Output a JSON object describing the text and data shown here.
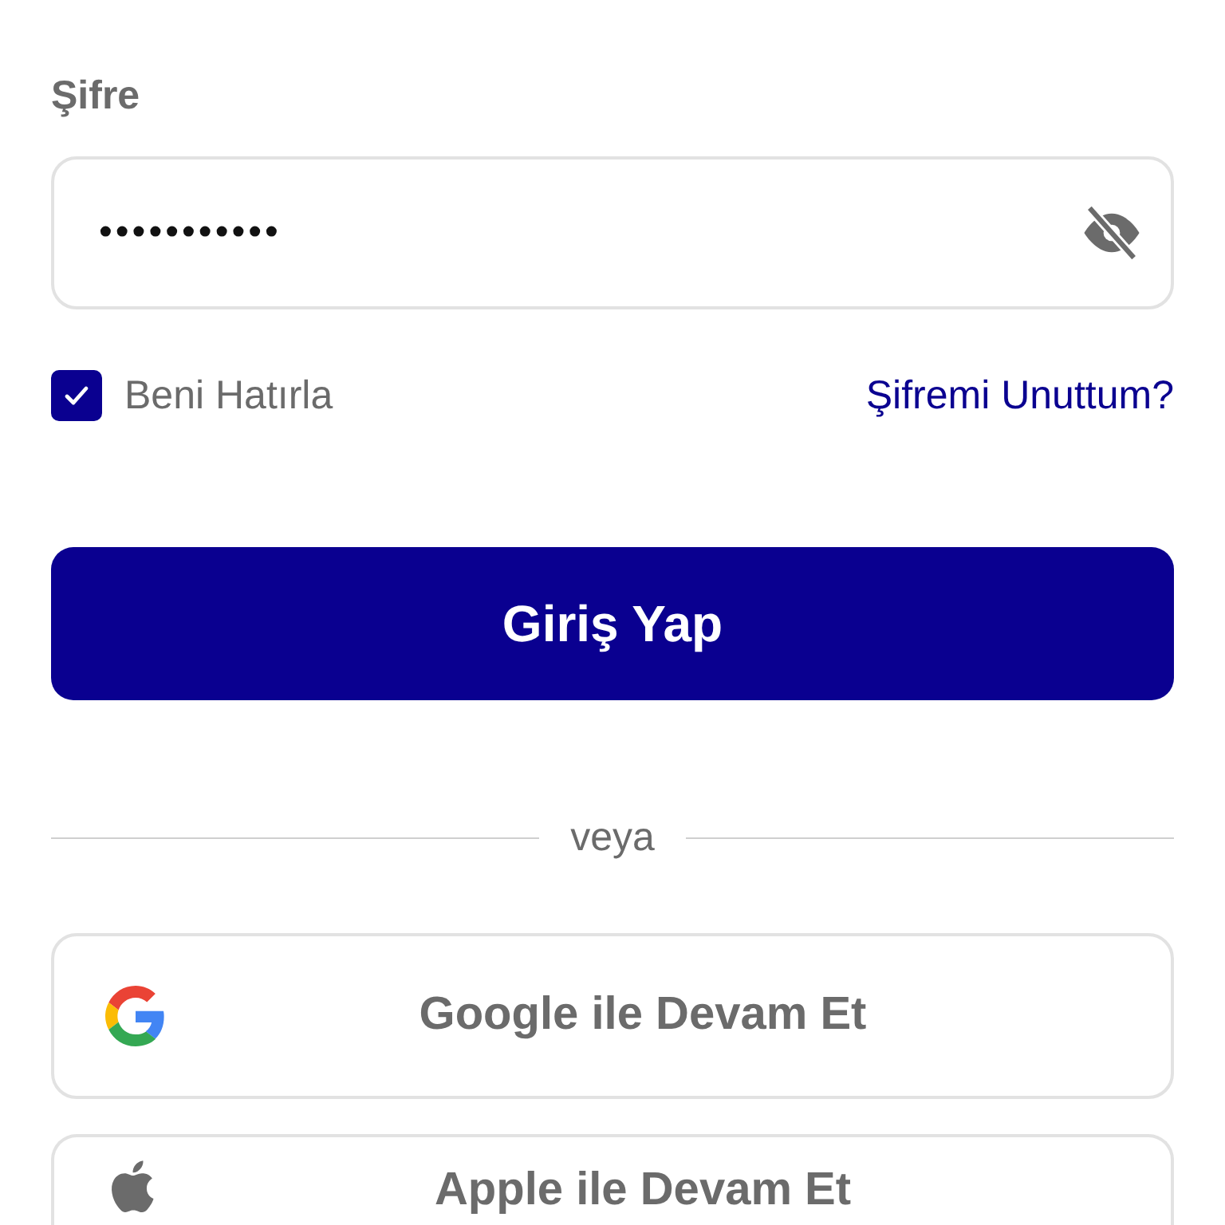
{
  "password": {
    "label": "Şifre",
    "value": "•••••••••••",
    "visible": false
  },
  "remember": {
    "label": "Beni Hatırla",
    "checked": true
  },
  "forgot_link": "Şifremi Unuttum?",
  "login_button": "Giriş Yap",
  "divider": "veya",
  "social_buttons": [
    {
      "kind": "google",
      "label": "Google ile Devam Et"
    },
    {
      "kind": "apple",
      "label": "Apple ile Devam Et"
    }
  ]
}
